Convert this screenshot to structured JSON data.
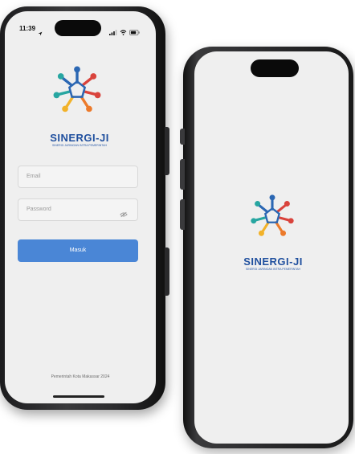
{
  "phone_login": {
    "status_time": "11:39",
    "brand_name": "SINERGI-JI",
    "brand_tagline": "SINERGI JARINGAN INTRA PEMERINTAH",
    "email_placeholder": "Email",
    "password_placeholder": "Password",
    "login_button": "Masuk",
    "footer_text": "Pemerintah Kota Makassar 2024"
  },
  "phone_splash": {
    "brand_name": "SINERGI-JI",
    "brand_tagline": "SINERGI JARINGAN INTRA PEMERINTAH"
  },
  "icons": {
    "logo": "sinergi-people-ring-icon",
    "password_toggle": "eye-off-icon",
    "signal": "signal-icon",
    "wifi": "wifi-icon",
    "battery": "battery-icon",
    "location": "location-arrow-icon"
  },
  "colors": {
    "brand_text": "#1f4f9e",
    "button": "#4a86d6",
    "screen_bg": "#efefef",
    "logo_blue": "#2b67b3",
    "logo_teal": "#27a6a1",
    "logo_red": "#d9433c",
    "logo_yellow": "#f2b229",
    "logo_orange": "#ec7a2b"
  }
}
